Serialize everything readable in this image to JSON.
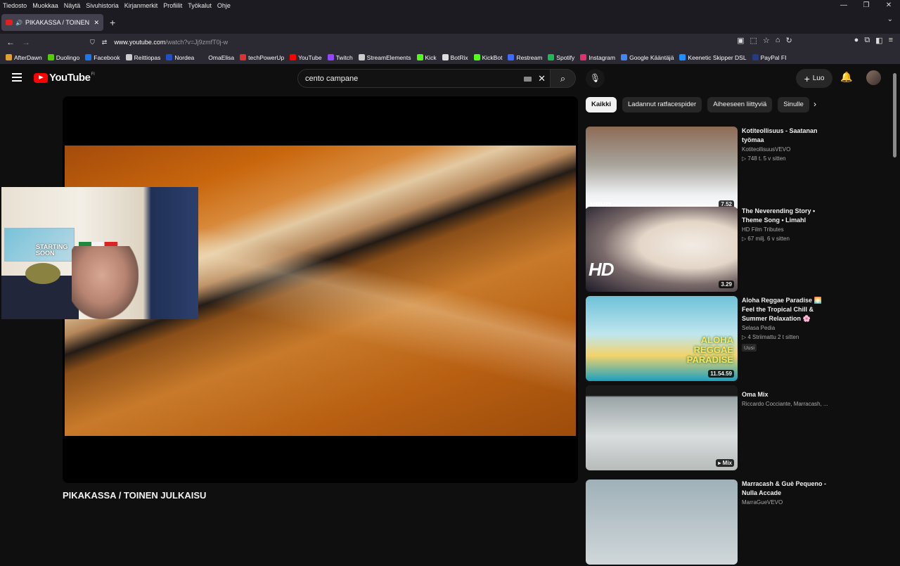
{
  "menubar": {
    "items": [
      "Tiedosto",
      "Muokkaa",
      "Näytä",
      "Sivuhistoria",
      "Kirjanmerkit",
      "Profiilit",
      "Työkalut",
      "Ohje"
    ]
  },
  "tab": {
    "title": "PIKAKASSA / TOINEN JULKAISU"
  },
  "address": {
    "host": "www.youtube.com",
    "path": "/watch?v=Jj9zmfT0j-w"
  },
  "bookmarks": [
    {
      "label": "AfterDawn",
      "color": "#e0a030"
    },
    {
      "label": "Duolingo",
      "color": "#58cc02"
    },
    {
      "label": "Facebook",
      "color": "#1877f2"
    },
    {
      "label": "Reittiopas",
      "color": "#cccccc"
    },
    {
      "label": "Nordea",
      "color": "#2050c8"
    },
    {
      "label": "OmaElisa",
      "color": "#2b2a33"
    },
    {
      "label": "techPowerUp",
      "color": "#e03030"
    },
    {
      "label": "YouTube",
      "color": "#ff0000"
    },
    {
      "label": "Twitch",
      "color": "#9146ff"
    },
    {
      "label": "StreamElements",
      "color": "#cccccc"
    },
    {
      "label": "Kick",
      "color": "#53fc18"
    },
    {
      "label": "BotRix",
      "color": "#dddddd"
    },
    {
      "label": "KickBot",
      "color": "#53fc18"
    },
    {
      "label": "Restream",
      "color": "#3b6cff"
    },
    {
      "label": "Spotify",
      "color": "#1db954"
    },
    {
      "label": "Instagram",
      "color": "#e1306c"
    },
    {
      "label": "Google Kääntäjä",
      "color": "#4285f4"
    },
    {
      "label": "Keenetic Skipper DSL",
      "color": "#1e90ff"
    },
    {
      "label": "PayPal FI",
      "color": "#253b80"
    }
  ],
  "yt": {
    "logo_word": "YouTube",
    "logo_cc": "FI",
    "search_value": "cento campane",
    "create_label": "Luo",
    "video_title": "PIKAKASSA / TOINEN JULKAISU",
    "cam_sign": "STARTING SOON"
  },
  "chips": [
    "Kaikki",
    "Ladannut ratfacespider",
    "Aiheeseen liittyviä",
    "Sinulle"
  ],
  "recs": [
    {
      "title": "Kotiteollisuus - Saatanan työmaa",
      "channel": "KotiteollisuusVEVO",
      "views": "▷ 748 t.   5 v sitten",
      "duration": "7.52",
      "overlay": "vevo",
      "badge": ""
    },
    {
      "title": "The Neverending Story • Theme Song • Limahl",
      "channel": "HD Film Tributes",
      "views": "▷ 67 milj.   6 v sitten",
      "duration": "3.29",
      "overlay": "HD",
      "badge": ""
    },
    {
      "title": "Aloha Reggae Paradise 🌅 Feel the Tropical Chill & Summer Relaxation 🌸",
      "channel": "Selasa Pedia",
      "views": "▷ 4   Striimattu 2 t sitten",
      "duration": "11.54.59",
      "overlay": "ALOHA REGGAE PARADISE",
      "badge": "Uusi"
    },
    {
      "title": "Oma Mix",
      "channel": "Riccardo Cocciante, Marracash, ...",
      "views": "",
      "duration": "Mix",
      "overlay": "",
      "badge": ""
    },
    {
      "title": "Marracash & Guè Pequeno - Nulla Accade",
      "channel": "MarraGueVEVO",
      "views": "",
      "duration": "",
      "overlay": "",
      "badge": ""
    }
  ],
  "colors": {
    "background": "#0f0f0f",
    "brand": "#ff0000",
    "chrome": "#2b2a33"
  }
}
